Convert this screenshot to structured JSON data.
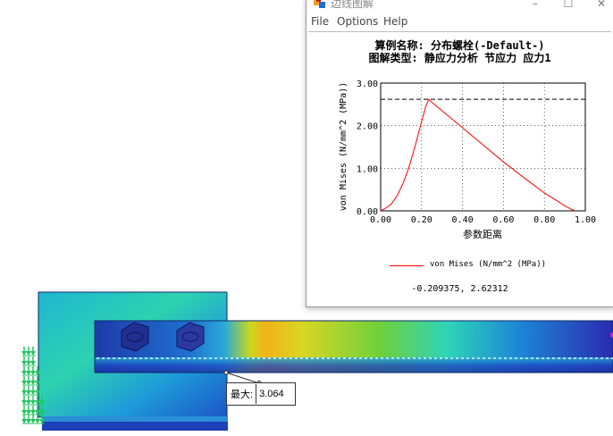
{
  "window": {
    "title": "边线图解",
    "app_icon": "solidworks-logo-icon",
    "controls": [
      "minimize-icon",
      "maximize-icon",
      "close-icon"
    ]
  },
  "menu": {
    "file": "File",
    "options": "Options",
    "help": "Help"
  },
  "plot": {
    "title_line1": "算例名称: 分布螺栓(-Default-)",
    "title_line2": "图解类型: 静应力分析 节应力 应力1",
    "legend": "von Mises (N/mm^2 (MPa))",
    "coordinate_readout": "-0.209375, 2.62312"
  },
  "chart_data": {
    "type": "line",
    "xlabel": "参数距离",
    "ylabel": "von Mises (N/mm^2 (MPa))",
    "xlim": [
      0.0,
      1.0
    ],
    "ylim": [
      0.0,
      3.0
    ],
    "x_ticks": [
      "0.00",
      "0.20",
      "0.40",
      "0.60",
      "0.80",
      "1.00"
    ],
    "y_ticks": [
      "0.00",
      "1.00",
      "2.00",
      "3.00"
    ],
    "grid": true,
    "reference_line_y": 2.62,
    "series": [
      {
        "name": "von Mises (N/mm^2 (MPa))",
        "color": "#ff0000",
        "x": [
          0.0,
          0.02,
          0.05,
          0.08,
          0.11,
          0.14,
          0.17,
          0.2,
          0.22,
          0.235,
          0.25,
          0.3,
          0.4,
          0.5,
          0.6,
          0.7,
          0.8,
          0.86,
          0.9,
          0.93,
          0.95
        ],
        "y": [
          0.0,
          0.05,
          0.15,
          0.35,
          0.65,
          1.05,
          1.55,
          2.1,
          2.45,
          2.62,
          2.55,
          2.35,
          1.95,
          1.55,
          1.15,
          0.78,
          0.42,
          0.24,
          0.12,
          0.04,
          0.0
        ]
      }
    ]
  },
  "model": {
    "max_label": "最大:",
    "max_value": "3.064",
    "load_arrow_color": "#22c55e"
  }
}
